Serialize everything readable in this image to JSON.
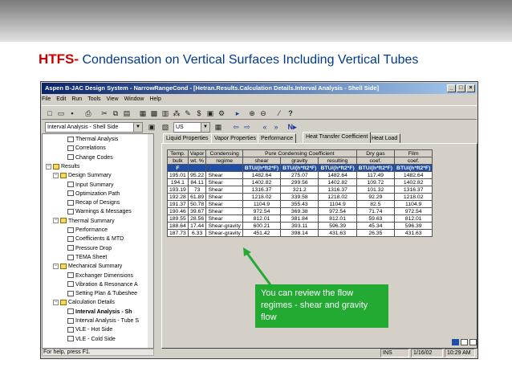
{
  "slide": {
    "title_bold": "HTFS-",
    "title_rest": "Condensation on Vertical Surfaces Including Vertical Tubes"
  },
  "window": {
    "title": "Aspen B-JAC Design System - NarrowRangeCond - [Hetran.Results.Calculation Details.Interval Analysis - Shell Side]"
  },
  "menu": [
    "File",
    "Edit",
    "Run",
    "Tools",
    "View",
    "Window",
    "Help"
  ],
  "toolbar2": {
    "section_combo": "Interval Analysis - Shell Side",
    "units_combo": "US"
  },
  "tree": [
    {
      "label": "Thermal Analysis",
      "indent": 3,
      "kind": "doc"
    },
    {
      "label": "Correlations",
      "indent": 3,
      "kind": "doc"
    },
    {
      "label": "Change Codes",
      "indent": 3,
      "kind": "doc"
    },
    {
      "label": "Results",
      "indent": 0,
      "kind": "folder"
    },
    {
      "label": "Design Summary",
      "indent": 1,
      "kind": "folder"
    },
    {
      "label": "Input Summary",
      "indent": 3,
      "kind": "doc"
    },
    {
      "label": "Optimization Path",
      "indent": 3,
      "kind": "doc"
    },
    {
      "label": "Recap of Designs",
      "indent": 3,
      "kind": "doc"
    },
    {
      "label": "Warnings & Messages",
      "indent": 3,
      "kind": "doc"
    },
    {
      "label": "Thermal Summary",
      "indent": 1,
      "kind": "folder"
    },
    {
      "label": "Performance",
      "indent": 3,
      "kind": "doc"
    },
    {
      "label": "Coefficients & MTD",
      "indent": 3,
      "kind": "doc"
    },
    {
      "label": "Pressure Drop",
      "indent": 3,
      "kind": "doc"
    },
    {
      "label": "TEMA Sheet",
      "indent": 3,
      "kind": "doc"
    },
    {
      "label": "Mechanical Summary",
      "indent": 1,
      "kind": "folder"
    },
    {
      "label": "Exchanger Dimensions",
      "indent": 3,
      "kind": "doc"
    },
    {
      "label": "Vibration & Resonance A",
      "indent": 3,
      "kind": "doc"
    },
    {
      "label": "Setting Plan & Tubeshee",
      "indent": 3,
      "kind": "doc"
    },
    {
      "label": "Calculation Details",
      "indent": 1,
      "kind": "folder"
    },
    {
      "label": "Interval Analysis - Sh",
      "indent": 3,
      "kind": "doc",
      "bold": true
    },
    {
      "label": "Interval Analysis - Tube S",
      "indent": 3,
      "kind": "doc"
    },
    {
      "label": "VLE - Hot Side",
      "indent": 3,
      "kind": "doc"
    },
    {
      "label": "VLE - Cold Side",
      "indent": 3,
      "kind": "doc"
    }
  ],
  "tabs": [
    "Liquid Properties",
    "Vapor Properties",
    "Performance",
    "Heat Transfer Coefficient",
    "Heat Load"
  ],
  "table": {
    "h1": [
      "Temp.",
      "Vapor",
      "Condensing",
      "Pure Condensing Coefficient",
      "Dry gas",
      "Film"
    ],
    "h2": [
      "bulk",
      "wt. %",
      "regime",
      "shear",
      "gravity",
      "resulting",
      "coef.",
      "coef."
    ],
    "units": [
      "F",
      "",
      "",
      "BTU/(h*ft2*F)",
      "BTU/(h*ft2*F)",
      "BTU/(h*ft2*F)",
      "BTU/(h*ft2*F)",
      "BTU/(h*ft2*F)"
    ],
    "rows": [
      [
        "195.01",
        "95.22",
        "Shear",
        "1482.64",
        "275.07",
        "1482.64",
        "117.49",
        "1482.64"
      ],
      [
        "194.1",
        "84.11",
        "Shear",
        "1402.82",
        "299.56",
        "1402.82",
        "109.72",
        "1402.82"
      ],
      [
        "193.19",
        "73",
        "Shear",
        "1316.37",
        "321.2",
        "1316.37",
        "101.32",
        "1316.37"
      ],
      [
        "192.28",
        "61.89",
        "Shear",
        "1218.02",
        "339.58",
        "1218.02",
        "92.29",
        "1218.02"
      ],
      [
        "191.37",
        "50.78",
        "Shear",
        "1104.9",
        "355.43",
        "1104.9",
        "82.5",
        "1104.9"
      ],
      [
        "190.46",
        "39.67",
        "Shear",
        "972.54",
        "369.38",
        "972.54",
        "71.74",
        "972.54"
      ],
      [
        "189.55",
        "28.56",
        "Shear",
        "812.01",
        "381.84",
        "812.01",
        "59.63",
        "812.01"
      ],
      [
        "188.64",
        "17.44",
        "Shear-gravity",
        "600.21",
        "393.11",
        "596.39",
        "45.34",
        "596.39"
      ],
      [
        "187.73",
        "6.33",
        "Shear-gravity",
        "451.42",
        "398.14",
        "431.63",
        "26.35",
        "431.63"
      ]
    ]
  },
  "callout": "You can review the flow regimes - shear and gravity flow",
  "status": {
    "help": "For help, press F1.",
    "mode": "INS",
    "date": "1/16/02",
    "time": "10:29 AM"
  },
  "colors": {
    "title_red": "#cc0000",
    "title_blue": "#003a8c",
    "callout_green": "#22aa33",
    "units_blue": "#1f4ea8"
  }
}
